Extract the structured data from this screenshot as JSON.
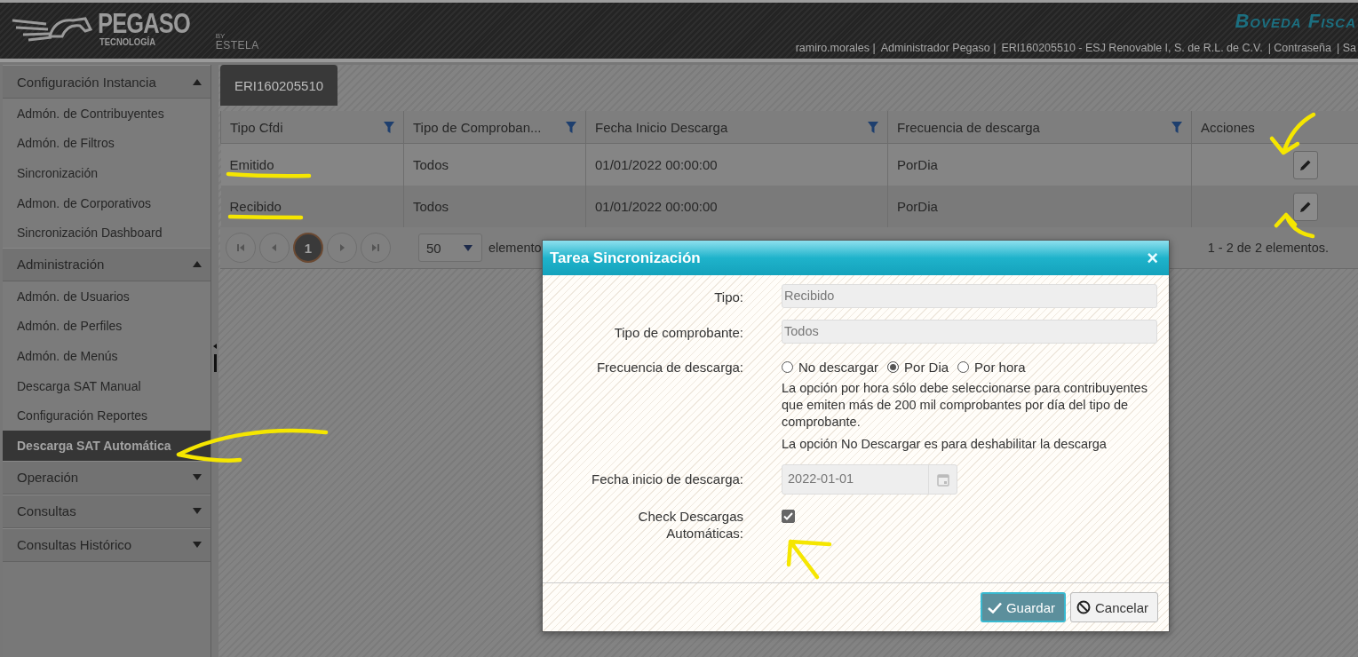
{
  "header": {
    "brand": "PEGASO",
    "brand_subtitle": "TECNOLOGÍA",
    "partner_prefix": "BY",
    "partner": "ESTELA",
    "product": "Boveda Fisca",
    "user_links": [
      "ramiro.morales |",
      "Administrador Pegaso |",
      "ERI160205510 - ESJ Renovable I, S. de R.L. de C.V.",
      "| Contraseña",
      "| Sa"
    ]
  },
  "sidebar": {
    "sections": [
      {
        "title": "Configuración Instancia",
        "expanded": true,
        "items": [
          {
            "label": "Admón. de Contribuyentes",
            "selected": false
          },
          {
            "label": "Admón. de Filtros",
            "selected": false
          },
          {
            "label": "Sincronización",
            "selected": false
          },
          {
            "label": "Admon. de Corporativos",
            "selected": false
          },
          {
            "label": "Sincronización Dashboard",
            "selected": false
          }
        ]
      },
      {
        "title": "Administración",
        "expanded": true,
        "items": [
          {
            "label": "Admón. de Usuarios",
            "selected": false
          },
          {
            "label": "Admón. de Perfiles",
            "selected": false
          },
          {
            "label": "Admón. de Menús",
            "selected": false
          },
          {
            "label": "Descarga SAT Manual",
            "selected": false
          },
          {
            "label": "Configuración Reportes",
            "selected": false
          },
          {
            "label": "Descarga SAT Automática",
            "selected": true
          }
        ]
      },
      {
        "title": "Operación",
        "expanded": false
      },
      {
        "title": "Consultas",
        "expanded": false
      },
      {
        "title": "Consultas Histórico",
        "expanded": false
      }
    ]
  },
  "tabs": [
    {
      "label": "ERI160205510",
      "selected": true
    }
  ],
  "table": {
    "columns": [
      {
        "label": "Tipo Cfdi",
        "filter": true,
        "kind": "text"
      },
      {
        "label": "Tipo de Comproban...",
        "filter": true,
        "kind": "text"
      },
      {
        "label": "Fecha Inicio Descarga",
        "filter": true,
        "kind": "text"
      },
      {
        "label": "Frecuencia de descarga",
        "filter": true,
        "kind": "text"
      },
      {
        "label": "Acciones",
        "filter": false,
        "kind": "actions"
      }
    ],
    "rows": [
      {
        "cells": [
          "Emitido",
          "Todos",
          "01/01/2022 00:00:00",
          "PorDia"
        ]
      },
      {
        "cells": [
          "Recibido",
          "Todos",
          "01/01/2022 00:00:00",
          "PorDia"
        ]
      }
    ]
  },
  "pager": {
    "pages": [
      {
        "label": "1",
        "selected": true
      }
    ],
    "page_size": "50",
    "page_size_label": "elemento",
    "summary": "1 - 2 de 2 elementos."
  },
  "dialog": {
    "title": "Tarea Sincronización",
    "close": "×",
    "fields": [
      {
        "kind": "text",
        "label": "Tipo:",
        "value": "Recibido",
        "disabled": true
      },
      {
        "kind": "text",
        "label": "Tipo de comprobante:",
        "value": "Todos",
        "disabled": true
      },
      {
        "kind": "radio",
        "label": "Frecuencia de descarga:",
        "options": [
          {
            "label": "No descargar",
            "selected": false
          },
          {
            "label": "Por Dia",
            "selected": true
          },
          {
            "label": "Por hora",
            "selected": false
          }
        ],
        "notes": [
          "La opción por hora sólo debe seleccionarse para contribuyentes que emiten más de 200 mil comprobantes por día del tipo de comprobante.",
          "La opción No Descargar es para deshabilitar la descarga"
        ]
      },
      {
        "kind": "date",
        "label": "Fecha inicio de descarga:",
        "value": "2022-01-01",
        "disabled": true
      },
      {
        "kind": "checkbox",
        "label": "Check Descargas Automáticas:",
        "checked": true
      }
    ],
    "buttons": [
      {
        "kind": "primary",
        "label": "Guardar"
      },
      {
        "kind": "cancel",
        "label": "Cancelar"
      }
    ]
  }
}
